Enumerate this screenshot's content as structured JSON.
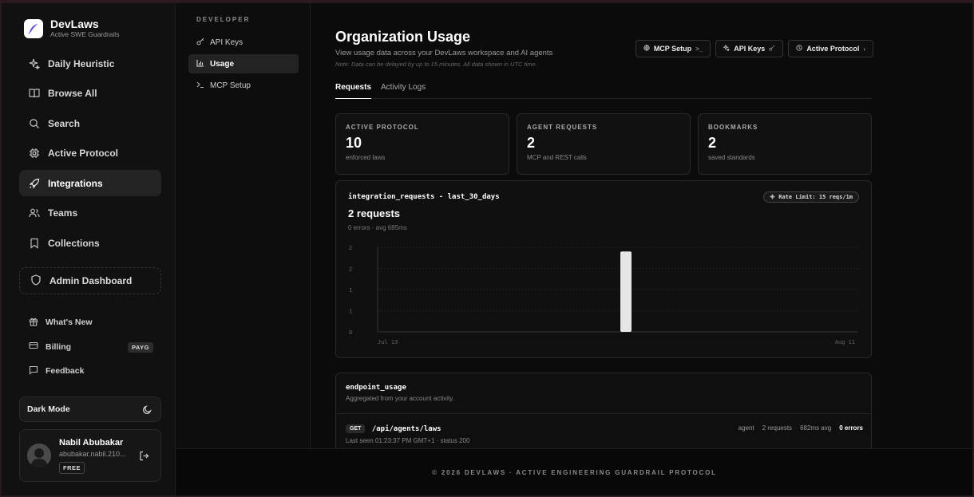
{
  "brand": {
    "name": "DevLaws",
    "subtitle": "Active SWE Guardrails"
  },
  "nav": {
    "items": [
      {
        "label": "Daily Heuristic",
        "icon": "sparkles-icon"
      },
      {
        "label": "Browse All",
        "icon": "book-icon"
      },
      {
        "label": "Search",
        "icon": "search-icon"
      },
      {
        "label": "Active Protocol",
        "icon": "cpu-icon"
      },
      {
        "label": "Integrations",
        "icon": "rocket-icon",
        "active": true
      },
      {
        "label": "Teams",
        "icon": "users-icon"
      },
      {
        "label": "Collections",
        "icon": "bookmark-icon"
      }
    ],
    "admin": "Admin Dashboard"
  },
  "secondary_nav": {
    "whats_new": "What's New",
    "billing": "Billing",
    "billing_badge": "PAYG",
    "feedback": "Feedback"
  },
  "theme": {
    "label": "Dark Mode"
  },
  "user": {
    "name": "Nabil Abubakar",
    "email": "abubakar.nabil.210...",
    "plan": "FREE"
  },
  "developer": {
    "title": "DEVELOPER",
    "items": [
      {
        "label": "API Keys"
      },
      {
        "label": "Usage",
        "active": true
      },
      {
        "label": "MCP Setup"
      }
    ]
  },
  "page": {
    "title": "Organization Usage",
    "subtitle": "View usage data across your DevLaws workspace and AI agents",
    "note": "Note: Data can be delayed by up to 15 minutes. All data shown in UTC time.",
    "buttons": {
      "mcp": "MCP Setup",
      "api": "API Keys",
      "protocol": "Active Protocol"
    },
    "tabs": [
      "Requests",
      "Activity Logs"
    ]
  },
  "stats": [
    {
      "label": "ACTIVE PROTOCOL",
      "value": "10",
      "desc": "enforced laws"
    },
    {
      "label": "AGENT REQUESTS",
      "value": "2",
      "desc": "MCP and REST calls"
    },
    {
      "label": "BOOKMARKS",
      "value": "2",
      "desc": "saved standards"
    }
  ],
  "chart_card": {
    "title": "integration_requests - last_30_days",
    "headline": "2 requests",
    "meta": "0 errors · avg 685ms",
    "rate_limit": "Rate Limit: 15 reqs/1m"
  },
  "chart_data": {
    "type": "bar",
    "x_start_label": "Jul 13",
    "x_end_label": "Aug 11",
    "y_tick_labels": [
      "2",
      "2",
      "1",
      "1",
      "0"
    ],
    "ylim": [
      0,
      2
    ],
    "num_days": 30,
    "values": [
      0,
      0,
      0,
      0,
      0,
      0,
      0,
      0,
      0,
      0,
      0,
      0,
      0,
      0,
      0,
      2,
      0,
      0,
      0,
      0,
      0,
      0,
      0,
      0,
      0,
      0,
      0,
      0,
      0,
      0
    ],
    "bar_color": "#e6e6e6",
    "grid": true
  },
  "endpoint": {
    "title": "endpoint_usage",
    "subtitle": "Aggregated from your account activity.",
    "rows": [
      {
        "method": "GET",
        "path": "/api/agents/laws",
        "actor": "agent",
        "requests": "2 requests",
        "avg": "682ms avg",
        "errors": "0 errors",
        "last_seen": "Last seen 01:23:37 PM GMT+1 · status 200"
      }
    ]
  },
  "footer": {
    "text": "© 2026 DEVLAWS · ACTIVE ENGINEERING GUARDRAIL PROTOCOL"
  }
}
